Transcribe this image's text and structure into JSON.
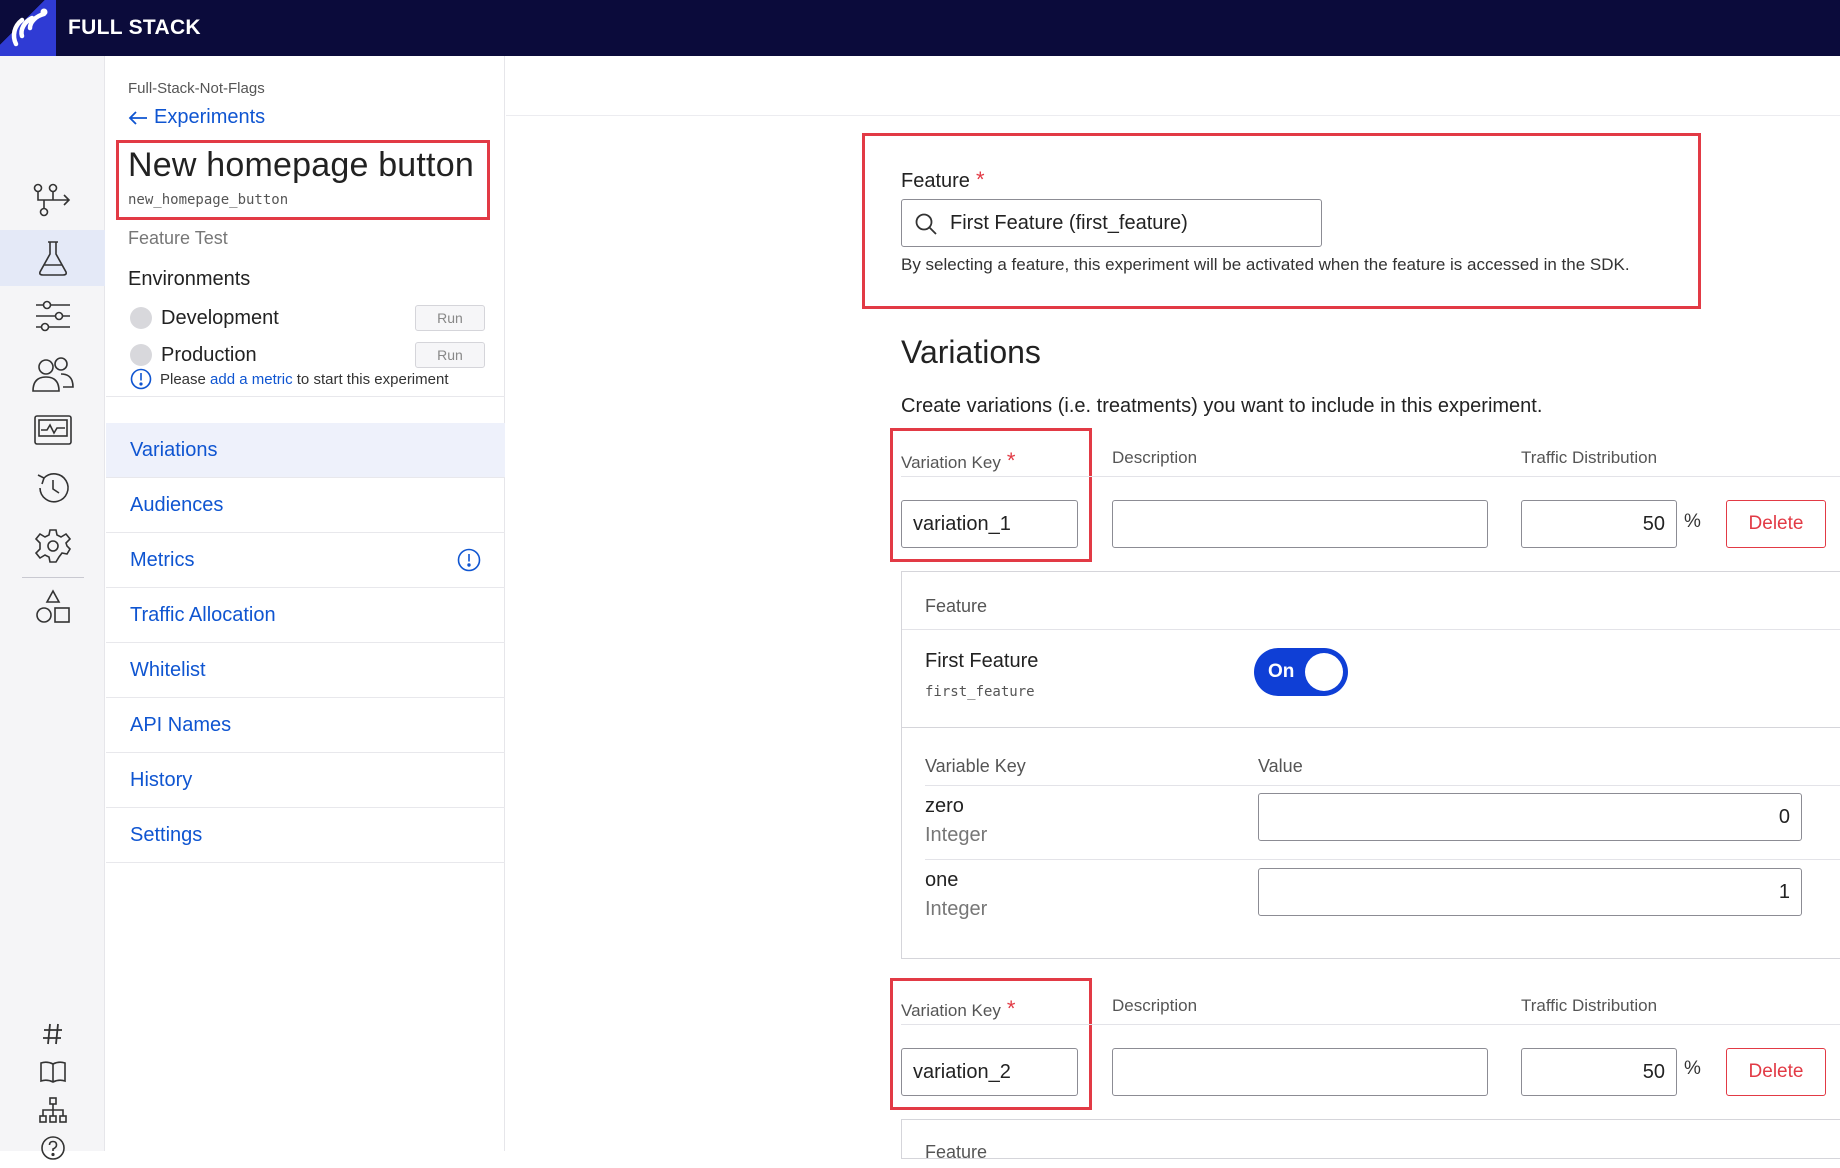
{
  "topbar": {
    "brand": "FULL STACK"
  },
  "rail": {
    "icons": [
      "flags-icon",
      "flask-icon",
      "sliders-icon",
      "users-icon",
      "monitor-icon",
      "history-icon",
      "gear-icon",
      "shapes-icon"
    ],
    "bottom_icons": [
      "hash-icon",
      "book-icon",
      "sitemap-icon",
      "help-icon"
    ]
  },
  "breadcrumb": {
    "project": "Full-Stack-Not-Flags",
    "back": "Experiments"
  },
  "experiment": {
    "title": "New homepage button",
    "key": "new_homepage_button",
    "type": "Feature Test"
  },
  "environments": {
    "heading": "Environments",
    "items": [
      {
        "name": "Development",
        "action": "Run"
      },
      {
        "name": "Production",
        "action": "Run"
      }
    ],
    "hint_prefix": "Please ",
    "hint_link": "add a metric",
    "hint_suffix": " to start this experiment"
  },
  "nav": {
    "items": [
      "Variations",
      "Audiences",
      "Metrics",
      "Traffic Allocation",
      "Whitelist",
      "API Names",
      "History",
      "Settings"
    ]
  },
  "feature_section": {
    "label": "Feature",
    "required_mark": "*",
    "selected": "First Feature (first_feature)",
    "help": "By selecting a feature, this experiment will be activated when the feature is accessed in the SDK."
  },
  "variations_section": {
    "title": "Variations",
    "description": "Create variations (i.e. treatments) you want to include in this experiment.",
    "col_key": "Variation Key",
    "col_description": "Description",
    "col_traffic": "Traffic Distribution",
    "percent_sign": "%",
    "delete_label": "Delete",
    "variations": [
      {
        "key": "variation_1",
        "description": "",
        "traffic": "50",
        "feature_label": "Feature",
        "feature_name": "First Feature",
        "feature_key": "first_feature",
        "toggle": "On",
        "col_variable_key": "Variable Key",
        "col_value": "Value",
        "variables": [
          {
            "name": "zero",
            "type": "Integer",
            "value": "0"
          },
          {
            "name": "one",
            "type": "Integer",
            "value": "1"
          }
        ]
      },
      {
        "key": "variation_2",
        "description": "",
        "traffic": "50",
        "feature_label": "Feature"
      }
    ]
  }
}
